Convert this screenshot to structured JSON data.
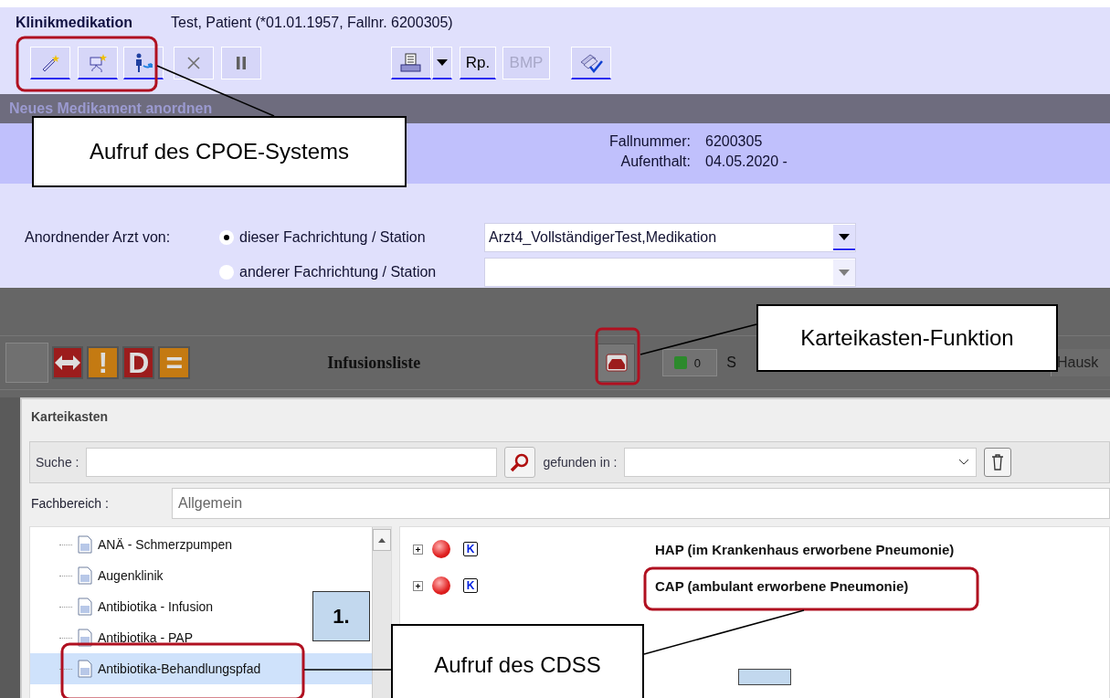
{
  "header": {
    "app_title": "Klinikmedikation",
    "patient": "Test, Patient (*01.01.1957, Fallnr. 6200305)"
  },
  "toolbar": [
    {
      "kind": "wand",
      "disabled": false
    },
    {
      "kind": "infusion",
      "disabled": false
    },
    {
      "kind": "person",
      "disabled": false
    },
    {
      "kind": "cross",
      "disabled": true
    },
    {
      "kind": "pause",
      "disabled": true
    },
    {
      "kind": "printer",
      "disabled": false
    },
    {
      "kind": "caret",
      "disabled": false
    },
    {
      "kind": "text",
      "label": "Rp.",
      "disabled": false
    },
    {
      "kind": "text",
      "label": "BMP",
      "disabled": true
    },
    {
      "kind": "check",
      "disabled": false
    }
  ],
  "section_bar": {
    "title": "Neues Medikament anordnen"
  },
  "case_info": [
    {
      "label": "Fallnummer:",
      "value": "6200305"
    },
    {
      "label": "Aufenthalt:",
      "value": "04.05.2020 -"
    }
  ],
  "ordering": {
    "label": "Anordnender Arzt von:",
    "options": [
      {
        "label": "dieser Fachrichtung / Station",
        "selected": true,
        "value": "Arzt4_VollständigerTest,Medikation",
        "disabled": false
      },
      {
        "label": "anderer Fachrichtung / Station",
        "selected": false,
        "disabled": true
      }
    ]
  },
  "background_app": {
    "markers": [
      {
        "kind": "arrows",
        "color": "#9c1c1c"
      },
      {
        "kind": "text",
        "label": "!",
        "color": "#c47a12"
      },
      {
        "kind": "text",
        "label": "D",
        "color": "#9c1c1c"
      },
      {
        "kind": "text",
        "label": "=",
        "color": "#c47a12"
      }
    ],
    "list_title": "Infusionsliste",
    "counter": "0",
    "field_label": "S",
    "field_value": "Hausk"
  },
  "dialog": {
    "title": "Karteikasten",
    "search_label": "Suche :",
    "found_label": "gefunden in :",
    "department_label": "Fachbereich :",
    "department": "Allgemein",
    "tree": [
      {
        "label": "ANÄ - Schmerzpumpen",
        "selected": false
      },
      {
        "label": "Augenklinik",
        "selected": false
      },
      {
        "label": "Antibiotika - Infusion",
        "selected": false
      },
      {
        "label": "Antibiotika - PAP",
        "selected": false
      },
      {
        "label": "Antibiotika-Behandlungspfad",
        "selected": true
      }
    ],
    "entries": [
      {
        "title": "HAP (im Krankenhaus erworbene Pneumonie)",
        "badge": "K",
        "expanded": false
      },
      {
        "title": "CAP (ambulant erworbene Pneumonie)",
        "badge": "K",
        "expanded": false
      }
    ]
  },
  "callouts": [
    {
      "text": "Aufruf des CPOE-Systems"
    },
    {
      "text": "Karteikasten-Funktion"
    },
    {
      "text": "1."
    },
    {
      "text": "Aufruf des CDSS"
    }
  ]
}
